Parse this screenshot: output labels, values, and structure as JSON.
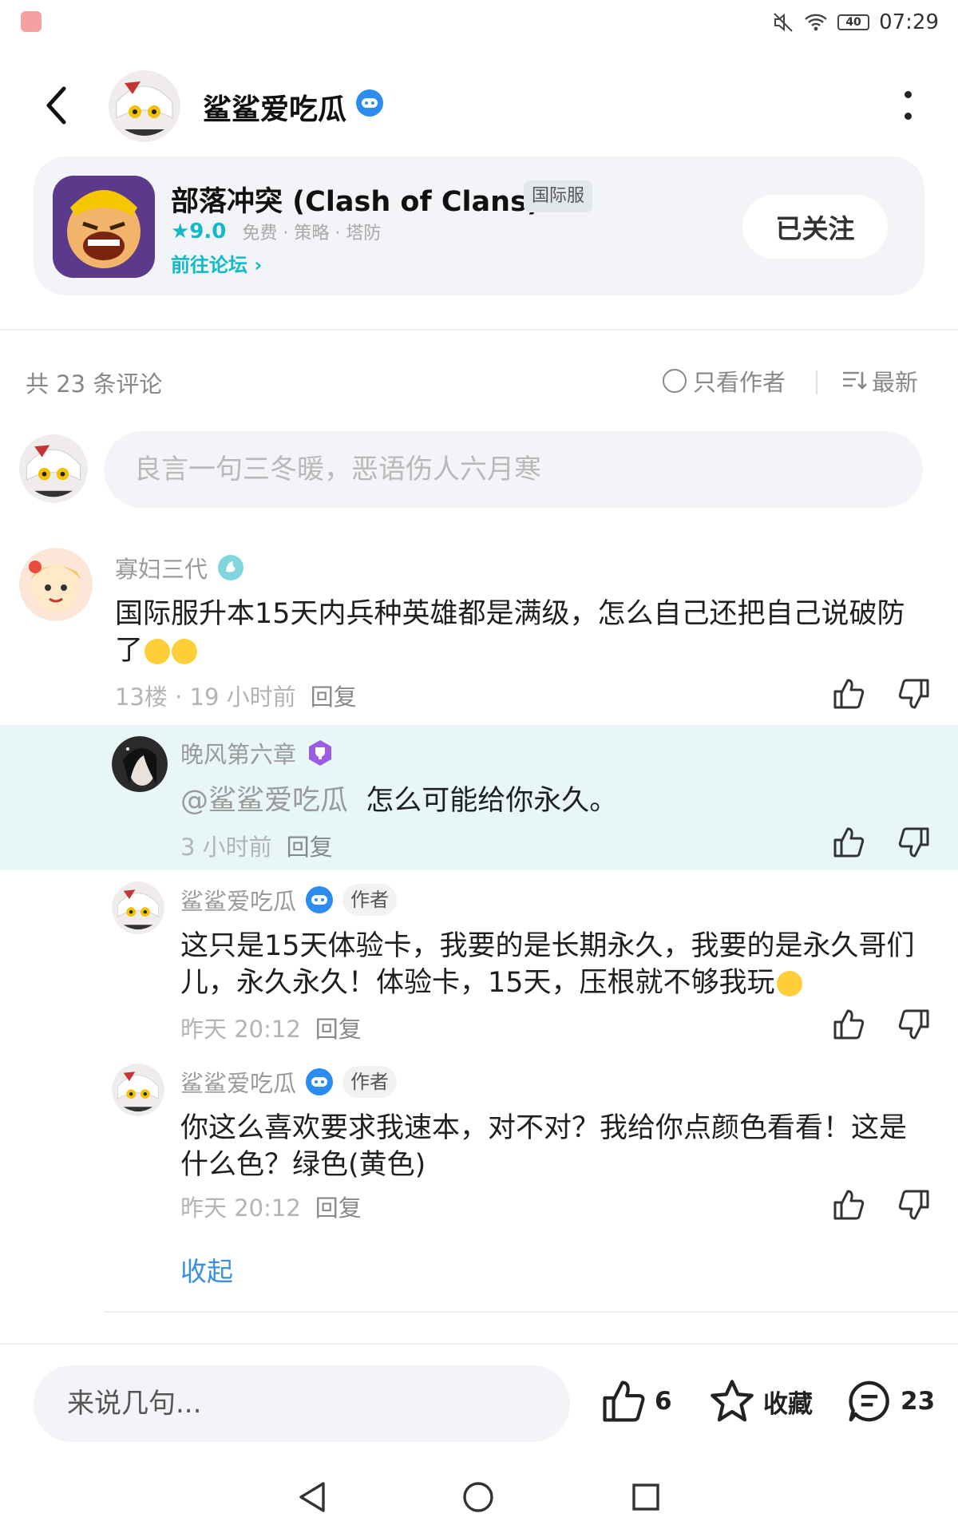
{
  "status_bar": {
    "time": "07:29",
    "battery": "40"
  },
  "header": {
    "author_name": "鲨鲨爱吃瓜"
  },
  "game": {
    "title": "部落冲突 (Clash of Clans)",
    "region_badge": "国际服",
    "rating": "★9.0",
    "tags": "免费 · 策略 · 塔防",
    "forum_link": "前往论坛 ›",
    "follow_label": "已关注"
  },
  "comments_header": {
    "count_text": "共 23 条评论",
    "only_author_label": "只看作者",
    "sort_label": "最新"
  },
  "input": {
    "placeholder": "良言一句三冬暖，恶语伤人六月寒"
  },
  "comments": [
    {
      "name": "寡妇三代",
      "text": "国际服升本15天内兵种英雄都是满级，怎么自己还把自己说破防了",
      "floor_time": "13楼 · 19 小时前",
      "reply_label": "回复"
    },
    {
      "name": "晚风第六章",
      "mention": "@鲨鲨爱吃瓜",
      "text": "怎么可能给你永久。",
      "time": "3 小时前",
      "reply_label": "回复"
    },
    {
      "name": "鲨鲨爱吃瓜",
      "badge": "作者",
      "text": "这只是15天体验卡，我要的是长期永久，我要的是永久哥们儿，永久永久！体验卡，15天，压根就不够我玩",
      "time": "昨天 20:12",
      "reply_label": "回复"
    },
    {
      "name": "鲨鲨爱吃瓜",
      "badge": "作者",
      "text": "你这么喜欢要求我速本，对不对？我给你点颜色看看！这是什么色？绿色(黄色)",
      "time": "昨天 20:12",
      "reply_label": "回复"
    }
  ],
  "collapse_label": "收起",
  "bottom_bar": {
    "input_placeholder": "来说几句...",
    "like_count": "6",
    "favorite_label": "收藏",
    "comment_count": "23"
  },
  "colors": {
    "accent": "#14b9c8",
    "link": "#3a8fdf",
    "verified": "#2d8cf0",
    "highlight": "#e8f6f7"
  }
}
